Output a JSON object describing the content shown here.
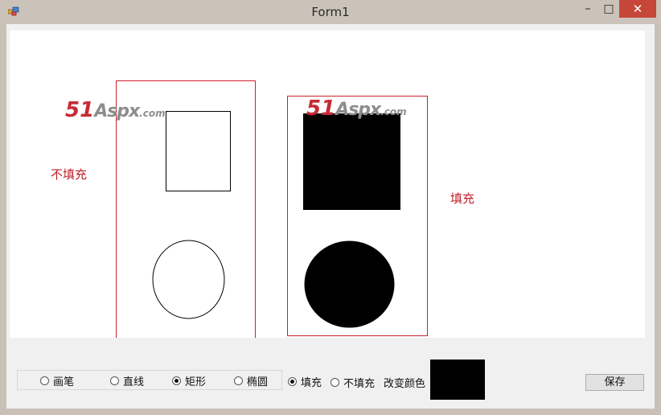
{
  "window": {
    "title": "Form1",
    "minimize_glyph": "–",
    "maximize_glyph": "□",
    "close_glyph": "✕",
    "icon": "app-window-icon"
  },
  "canvas": {
    "label_no_fill": "不填充",
    "label_fill": "填充",
    "watermark": {
      "num": "51",
      "word": "Aspx",
      "suffix": ".com"
    },
    "colors": {
      "frame": "#cc1f2b",
      "shape_stroke": "#000000",
      "shape_fill": "#000000",
      "label": "#c0202b"
    }
  },
  "toolbar": {
    "tool_options": [
      {
        "label": "画笔",
        "checked": false
      },
      {
        "label": "直线",
        "checked": false
      },
      {
        "label": "矩形",
        "checked": true
      },
      {
        "label": "椭圆",
        "checked": false
      }
    ],
    "fill_options": [
      {
        "label": "填充",
        "checked": true
      },
      {
        "label": "不填充",
        "checked": false
      }
    ],
    "change_color_label": "改变颜色",
    "current_color": "#000000",
    "save_label": "保存"
  }
}
